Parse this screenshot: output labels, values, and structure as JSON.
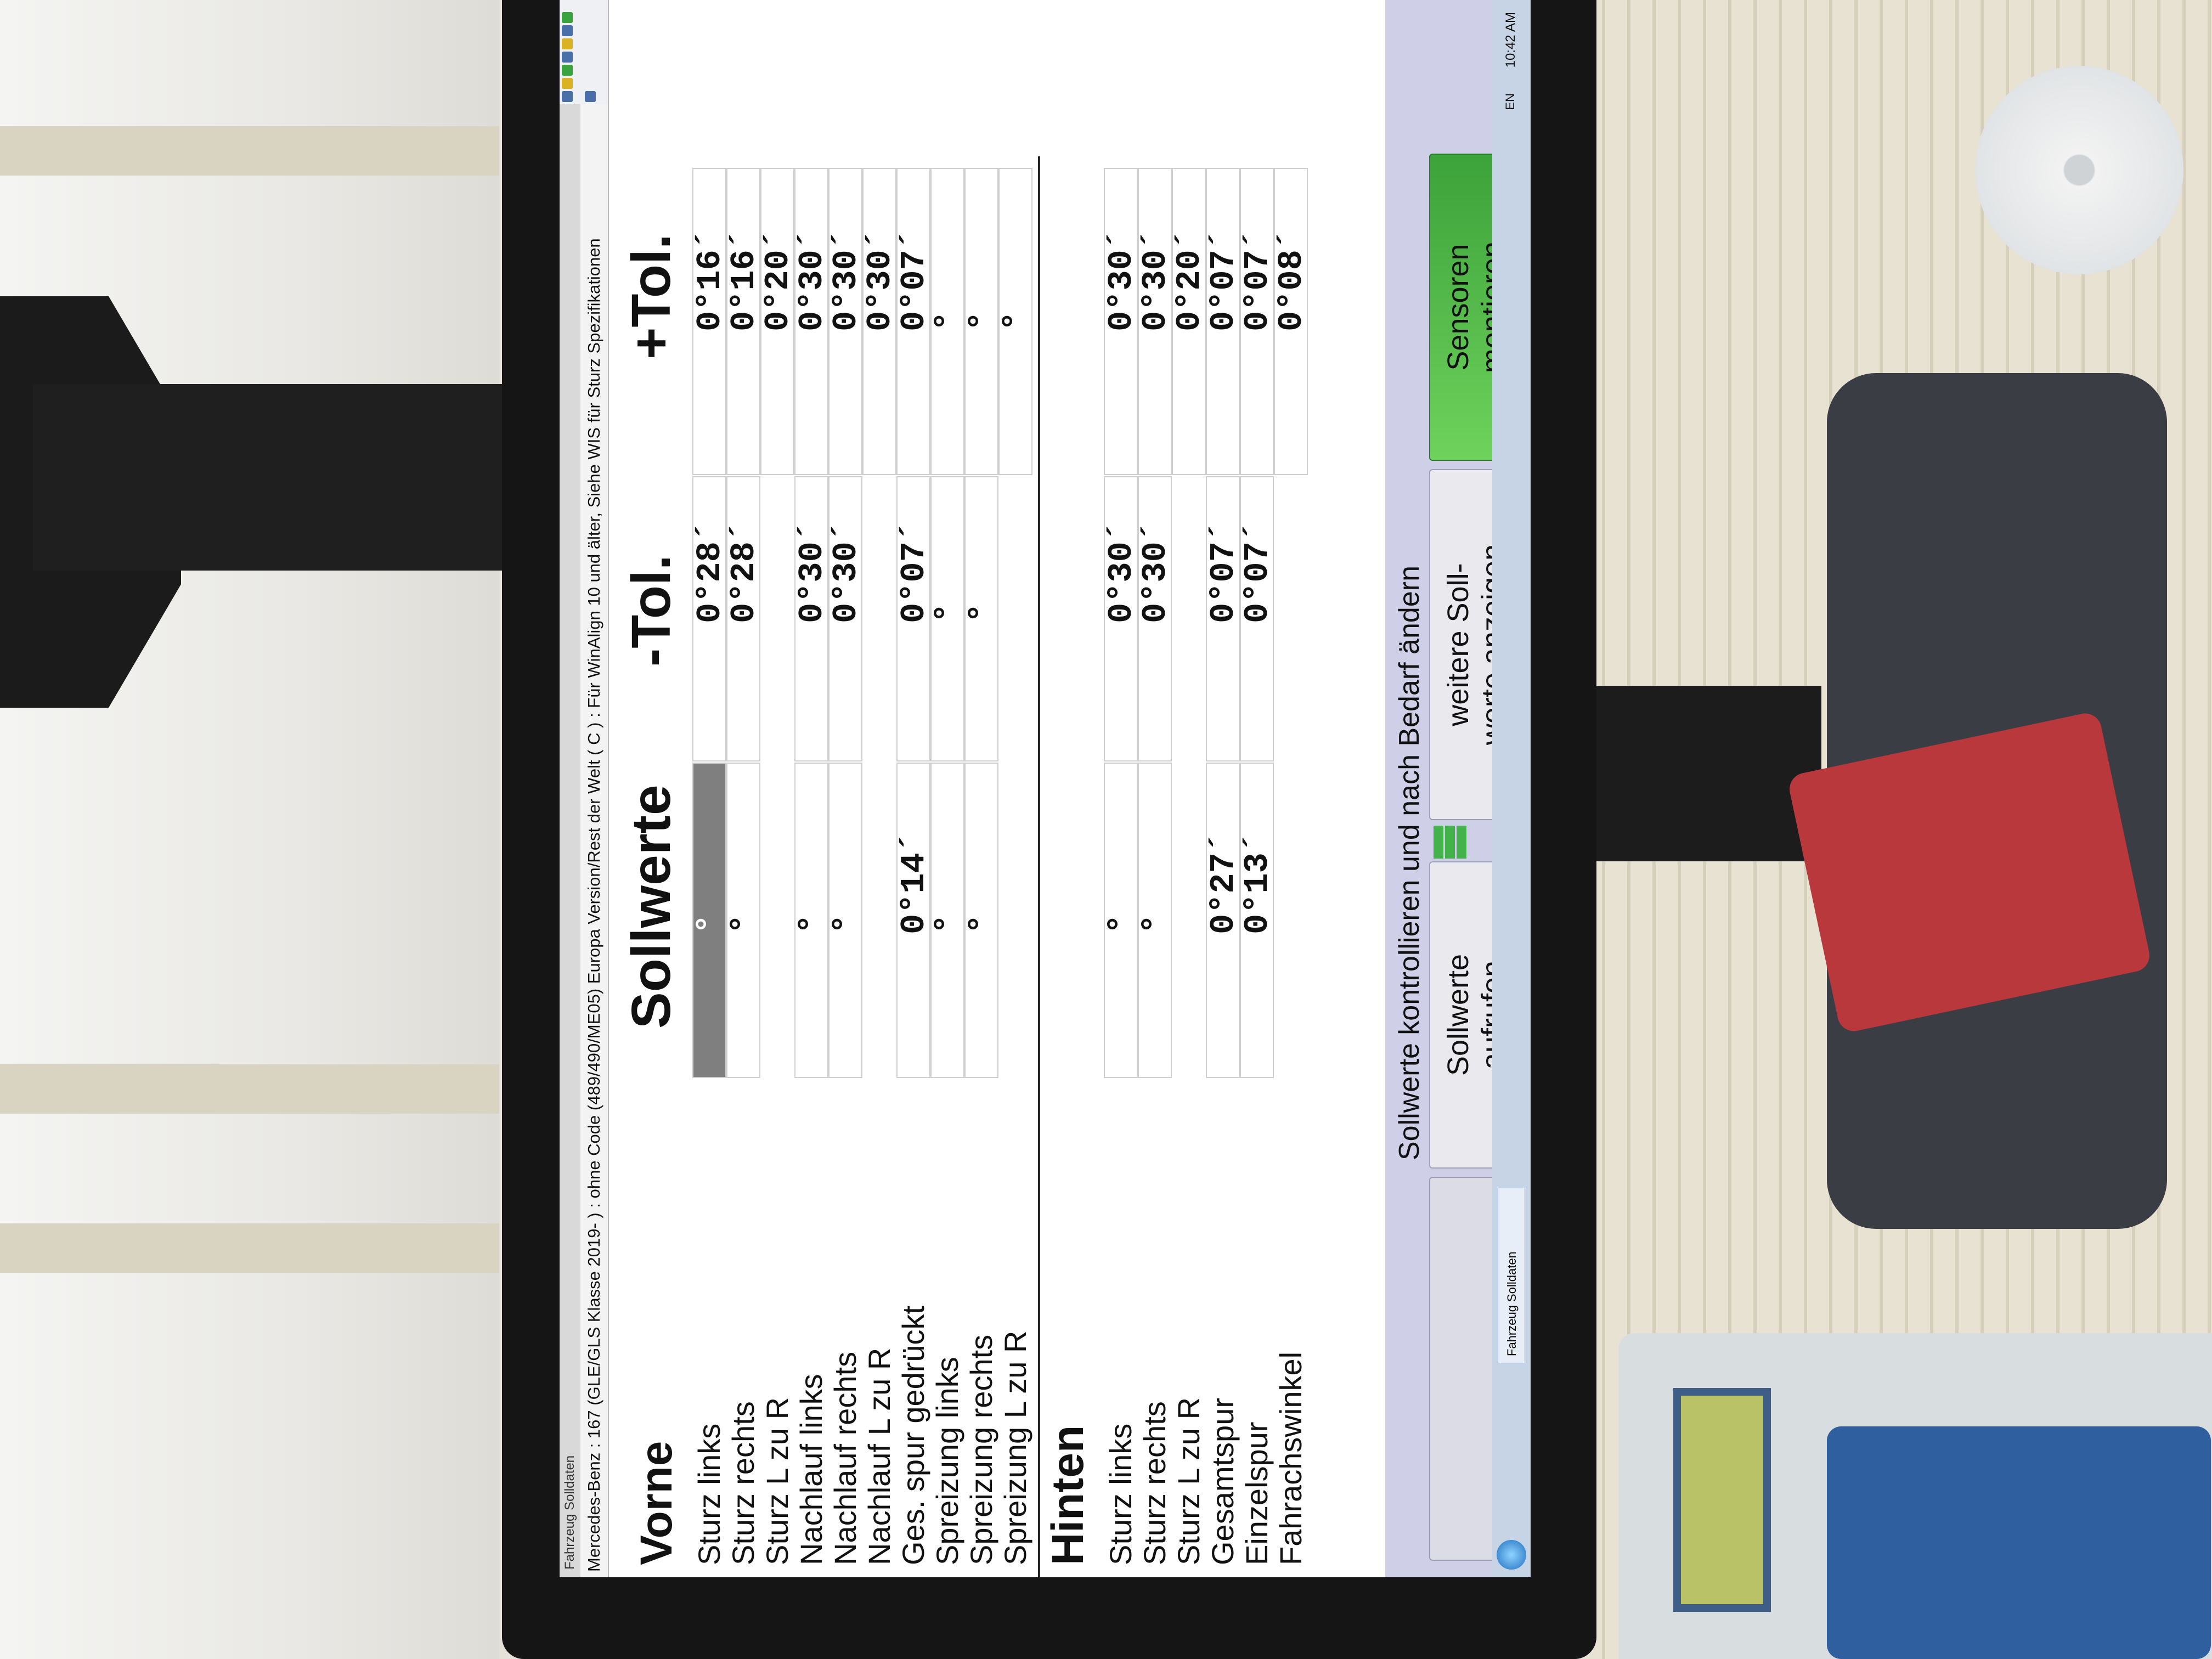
{
  "window": {
    "title": "Fahrzeug Solldaten",
    "header": "Mercedes-Benz : 167 (GLE/GLS Klasse 2019- ) : ohne Code (489/490/ME05) Europa Version/Rest der Welt ( C ) : Für WinAlign 10 und älter, Siehe WIS für Sturz Spezifikationen"
  },
  "columns": {
    "soll": "Sollwerte",
    "minus": "-Tol.",
    "plus": "+Tol."
  },
  "front": {
    "title": "Vorne",
    "rows": [
      {
        "label": "Sturz links",
        "soll": "°",
        "minus": "0°28´",
        "plus": "0°16´"
      },
      {
        "label": "Sturz rechts",
        "soll": "°",
        "minus": "0°28´",
        "plus": "0°16´"
      },
      {
        "label": "Sturz  L zu R",
        "soll": "",
        "minus": "",
        "plus": "0°20´"
      },
      {
        "label": "Nachlauf links",
        "soll": "°",
        "minus": "0°30´",
        "plus": "0°30´"
      },
      {
        "label": "Nachlauf rechts",
        "soll": "°",
        "minus": "0°30´",
        "plus": "0°30´"
      },
      {
        "label": "Nachlauf  L zu R",
        "soll": "",
        "minus": "",
        "plus": "0°30´"
      },
      {
        "label": "Ges. spur gedrückt",
        "soll": "0°14´",
        "minus": "0°07´",
        "plus": "0°07´"
      },
      {
        "label": "Spreizung links",
        "soll": "°",
        "minus": "°",
        "plus": "°"
      },
      {
        "label": "Spreizung rechts",
        "soll": "°",
        "minus": "°",
        "plus": "°"
      },
      {
        "label": "Spreizung L zu R",
        "soll": "",
        "minus": "",
        "plus": "°"
      }
    ]
  },
  "rear": {
    "title": "Hinten",
    "rows": [
      {
        "label": "Sturz links",
        "soll": "°",
        "minus": "0°30´",
        "plus": "0°30´"
      },
      {
        "label": "Sturz rechts",
        "soll": "°",
        "minus": "0°30´",
        "plus": "0°30´"
      },
      {
        "label": "Sturz  L zu R",
        "soll": "",
        "minus": "",
        "plus": "0°20´"
      },
      {
        "label": "Gesamtspur",
        "soll": "0°27´",
        "minus": "0°07´",
        "plus": "0°07´"
      },
      {
        "label": "Einzelspur",
        "soll": "0°13´",
        "minus": "0°07´",
        "plus": "0°07´"
      },
      {
        "label": "Fahrachswinkel",
        "soll": "",
        "minus": "",
        "plus": "0°08´"
      }
    ]
  },
  "footer": {
    "instruction": "Sollwerte kontrollieren und nach Bedarf ändern",
    "buttons": {
      "soll_aufrufen_1": "Sollwerte",
      "soll_aufrufen_2": "aufrufen",
      "weitere_1": "weitere Soll-",
      "weitere_2": "werte anzeigen",
      "sensoren_1": "Sensoren",
      "sensoren_2": "montieren"
    }
  },
  "taskbar": {
    "task": "Fahrzeug Solldaten",
    "lang": "EN",
    "clock": "10:42 AM"
  },
  "colors": {
    "highlight_cell": "#7f7f7f",
    "action_green": "#3ca23a",
    "button_panel": "#cfd0e8"
  }
}
